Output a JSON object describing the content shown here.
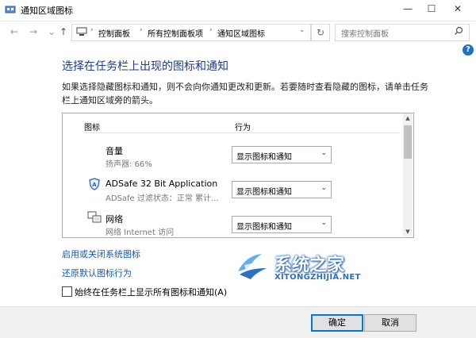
{
  "window": {
    "title": "通知区域图标",
    "minimize_glyph": "—",
    "maximize_glyph": "☐",
    "close_glyph": "✕"
  },
  "nav": {
    "back": "←",
    "forward": "→",
    "up": "↑"
  },
  "address": {
    "crumbs": [
      "控制面板",
      "所有控制面板项",
      "通知区域图标"
    ],
    "separator": "›",
    "dropdown_glyph": "⌄",
    "refresh_glyph": "↻"
  },
  "search": {
    "placeholder": "搜索控制面板"
  },
  "help_glyph": "?",
  "main": {
    "title": "选择在任务栏上出现的图标和通知",
    "description": "如果选择隐藏图标和通知，则不会向你通知更改和更新。若要随时查看隐藏的图标，请单击任务栏上通知区域旁的箭头。"
  },
  "table": {
    "col_icon": "图标",
    "col_action": "行为",
    "rows": [
      {
        "name": "音量",
        "sub": "扬声器: 66%",
        "action": "显示图标和通知",
        "icon": "speaker-icon"
      },
      {
        "name": "ADSafe 32 Bit Application",
        "sub": "ADSafe  过滤状态：正常  累计...",
        "action": "显示图标和通知",
        "icon": "adsafe-shield-icon"
      },
      {
        "name": "网络",
        "sub": "网络 Internet 访问",
        "action": "显示图标和通知",
        "icon": "network-icon"
      }
    ],
    "chevron": "⌄"
  },
  "links": {
    "system_icons": "启用或关闭系统图标",
    "restore_defaults": "还原默认图标行为"
  },
  "checkbox": {
    "label": "始终在任务栏上显示所有图标和通知(A)",
    "checked": false
  },
  "watermark": {
    "name": "系统之家",
    "url": "XITONGZHIJIA.NET"
  },
  "buttons": {
    "ok": "确定",
    "cancel": "取消"
  },
  "colors": {
    "title_blue": "#1e3b8c",
    "link_blue": "#1a56b0",
    "accent": "#0078d7"
  }
}
